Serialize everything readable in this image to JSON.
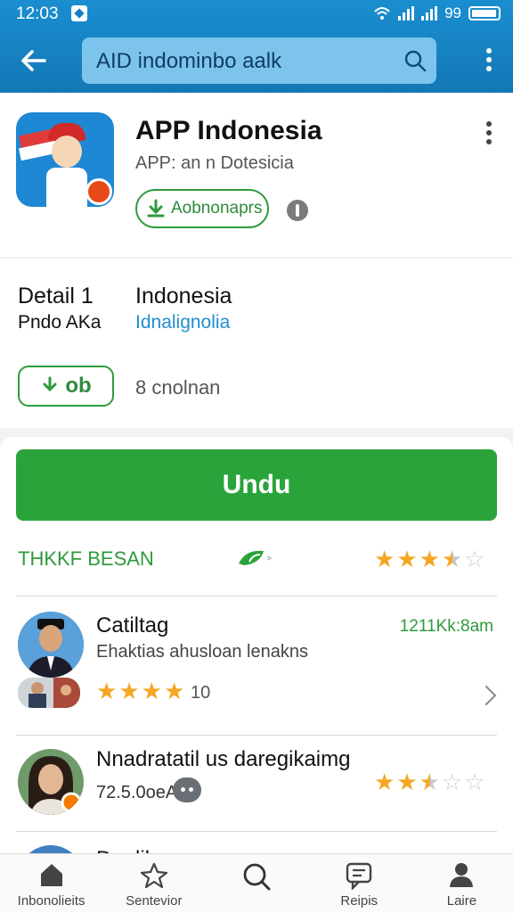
{
  "status_bar": {
    "time": "12:03",
    "battery_text": "99"
  },
  "search": {
    "value": "AID indominbo aalk"
  },
  "app": {
    "title": "APP Indonesia",
    "subtitle": "APP: an n Dotesicia",
    "install_label": "Aobnonaprs"
  },
  "details": {
    "left_title": "Detail 1",
    "left_sub": "Pndo AKa",
    "right_title": "Indonesia",
    "right_sub": "Idnalignolia",
    "download_label": "ob",
    "count_text": "8 cnolnan"
  },
  "main": {
    "primary_button": "Undu",
    "rating_label": "THKKF BESAN",
    "rating_stars": 3.5
  },
  "reviews": [
    {
      "name": "Catiltag",
      "text": "Ehaktias ahusloan lenakns",
      "time": "1211Kk:8am",
      "stars": 4,
      "count": "10"
    },
    {
      "name": "Nnadratatil us daregikaimg",
      "meta": "72.5.0oeA",
      "stars": 2.5
    },
    {
      "name": "Dnulikeno"
    }
  ],
  "nav": [
    {
      "label": "Inbonolieits",
      "icon": "home-icon"
    },
    {
      "label": "Sentevior",
      "icon": "star-icon"
    },
    {
      "label": "",
      "icon": "search-icon"
    },
    {
      "label": "Reipis",
      "icon": "chat-icon"
    },
    {
      "label": "Laire",
      "icon": "profile-icon"
    }
  ],
  "colors": {
    "appbar": "#1580c2",
    "accent_green": "#2aa33b",
    "star": "#f5a623",
    "link_blue": "#1f8ed0"
  }
}
